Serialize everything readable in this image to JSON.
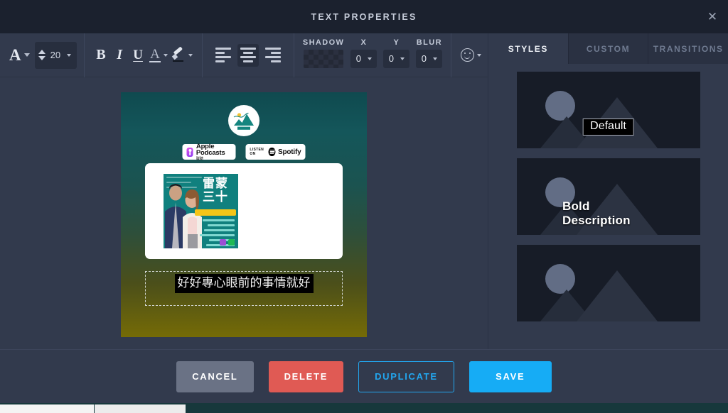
{
  "window": {
    "title": "TEXT PROPERTIES",
    "close_icon": "close-icon",
    "close_label": "✕"
  },
  "toolbar": {
    "font_family_button": {
      "icon": "font-family-icon",
      "glyph": "A"
    },
    "font_size": {
      "value": "20",
      "label": "font-size"
    },
    "bold": "B",
    "italic": "I",
    "underline": "U",
    "font_color": {
      "glyph": "A",
      "name": "font-color"
    },
    "highlight": {
      "name": "highlight-color"
    },
    "align": {
      "left": "align-left",
      "center": "align-center",
      "right": "align-right",
      "selected": "center"
    },
    "shadow": {
      "label": "SHADOW",
      "color_swatch": "transparent",
      "x": {
        "label": "X",
        "value": "0"
      },
      "y": {
        "label": "Y",
        "value": "0"
      },
      "blur": {
        "label": "BLUR",
        "value": "0"
      }
    },
    "emoji": {
      "name": "emoji-icon"
    }
  },
  "canvas": {
    "gradient_top": "#0f4a4f",
    "gradient_bottom": "#756b06",
    "logo_alt": "podcast-logo",
    "badges": [
      {
        "name": "apple-podcasts-badge",
        "line1": "Apple Podcasts",
        "line2": "聝聽"
      },
      {
        "name": "spotify-badge",
        "prefix": "LISTEN ON",
        "line1": "Spotify"
      }
    ],
    "episode_card": {
      "thumbnail_title_line1": "雷蒙",
      "thumbnail_title_line2": "三十"
    },
    "text_element": {
      "value": "好好專心眼前的事情就好",
      "selected": true
    }
  },
  "right_panel": {
    "tabs": [
      {
        "label": "STYLES",
        "active": true
      },
      {
        "label": "CUSTOM",
        "active": false
      },
      {
        "label": "TRANSITIONS",
        "active": false
      }
    ],
    "styles": [
      {
        "label": "Default",
        "style": "boxed"
      },
      {
        "label": "Bold Description",
        "style": "bold"
      },
      {
        "label": "",
        "style": "partial"
      }
    ]
  },
  "footer": {
    "cancel": "CANCEL",
    "delete": "DELETE",
    "duplicate": "DUPLICATE",
    "save": "SAVE"
  },
  "colors": {
    "modal_bg": "#323a4d",
    "titlebar_bg": "#1b212e",
    "accent_blue": "#16acf5",
    "danger_red": "#e05a54",
    "neutral_gray": "#6a7285"
  }
}
